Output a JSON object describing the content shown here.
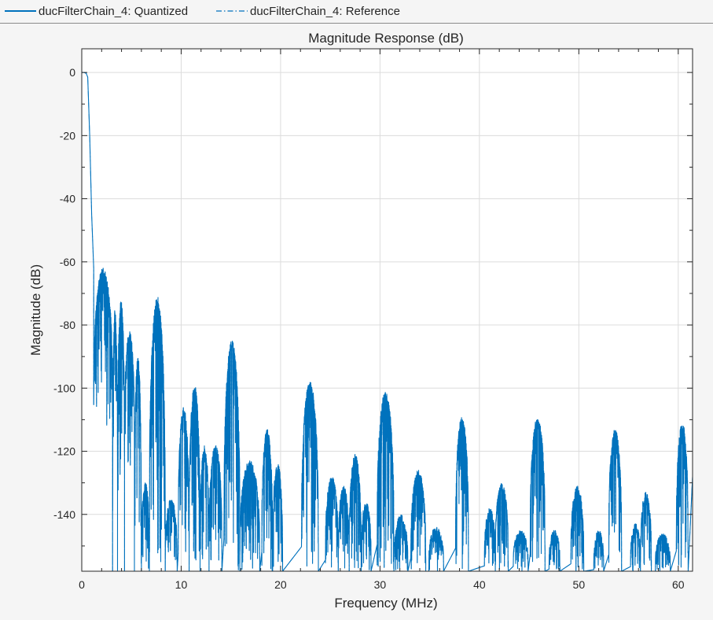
{
  "legend": {
    "items": [
      {
        "label": "ducFilterChain_4: Quantized",
        "style": "solid"
      },
      {
        "label": "ducFilterChain_4: Reference",
        "style": "dashdot"
      }
    ]
  },
  "colors": {
    "series": "#0072bd",
    "grid": "#dcdcdc",
    "axis": "#262626",
    "background": "#ffffff",
    "panel": "#f5f5f5"
  },
  "chart_data": {
    "type": "line",
    "title": "Magnitude Response (dB)",
    "xlabel": "Frequency (MHz)",
    "ylabel": "Magnitude (dB)",
    "xlim": [
      0,
      61.44
    ],
    "ylim": [
      -158,
      7.5
    ],
    "xticks": [
      0,
      10,
      20,
      30,
      40,
      50,
      60
    ],
    "xtick_labels": [
      "0",
      "10",
      "20",
      "30",
      "40",
      "50",
      "60"
    ],
    "yticks": [
      0,
      -20,
      -40,
      -60,
      -80,
      -100,
      -120,
      -140
    ],
    "ytick_labels": [
      "0",
      "-20",
      "-40",
      "-60",
      "-80",
      "-100",
      "-120",
      "-140"
    ],
    "grid": true,
    "legend_position": "top",
    "passband": {
      "x": [
        0,
        0.25,
        0.45,
        0.6
      ],
      "y": [
        0,
        0,
        -0.3,
        -1.5
      ]
    },
    "transition": {
      "x": [
        0.6,
        0.8,
        1.0,
        1.2
      ],
      "y": [
        -1.5,
        -20,
        -45,
        -62
      ]
    },
    "lobes": [
      {
        "start": 1.2,
        "end": 3.1,
        "peak": -62,
        "floor": -112
      },
      {
        "start": 2.2,
        "end": 3.6,
        "peak": -75,
        "floor": -140
      },
      {
        "start": 3.2,
        "end": 4.3,
        "peak": -72,
        "floor": -133
      },
      {
        "start": 4.3,
        "end": 5.3,
        "peak": -82,
        "floor": -125
      },
      {
        "start": 5.3,
        "end": 6.0,
        "peak": -90,
        "floor": -158
      },
      {
        "start": 5.9,
        "end": 6.8,
        "peak": -130,
        "floor": -158
      },
      {
        "start": 6.8,
        "end": 8.4,
        "peak": -71,
        "floor": -158
      },
      {
        "start": 8.4,
        "end": 9.6,
        "peak": -135,
        "floor": -158
      },
      {
        "start": 9.7,
        "end": 10.8,
        "peak": -106,
        "floor": -158
      },
      {
        "start": 10.8,
        "end": 11.9,
        "peak": -99,
        "floor": -158
      },
      {
        "start": 11.9,
        "end": 12.8,
        "peak": -118,
        "floor": -158
      },
      {
        "start": 12.8,
        "end": 14.1,
        "peak": -118,
        "floor": -158
      },
      {
        "start": 14.3,
        "end": 15.9,
        "peak": -85,
        "floor": -158
      },
      {
        "start": 15.9,
        "end": 17.9,
        "peak": -123,
        "floor": -158
      },
      {
        "start": 18.1,
        "end": 19.2,
        "peak": -113,
        "floor": -158
      },
      {
        "start": 19.2,
        "end": 20.2,
        "peak": -124,
        "floor": -158
      },
      {
        "start": 22.1,
        "end": 23.8,
        "peak": -98,
        "floor": -158
      },
      {
        "start": 24.5,
        "end": 25.8,
        "peak": -128,
        "floor": -158
      },
      {
        "start": 25.8,
        "end": 26.9,
        "peak": -131,
        "floor": -158
      },
      {
        "start": 26.9,
        "end": 28.1,
        "peak": -121,
        "floor": -158
      },
      {
        "start": 28.1,
        "end": 29.1,
        "peak": -136,
        "floor": -158
      },
      {
        "start": 29.7,
        "end": 31.4,
        "peak": -101,
        "floor": -158
      },
      {
        "start": 31.4,
        "end": 32.8,
        "peak": -140,
        "floor": -158
      },
      {
        "start": 33.1,
        "end": 34.6,
        "peak": -126,
        "floor": -158
      },
      {
        "start": 34.9,
        "end": 36.4,
        "peak": -144,
        "floor": -158
      },
      {
        "start": 37.6,
        "end": 38.9,
        "peak": -109,
        "floor": -158
      },
      {
        "start": 40.5,
        "end": 41.6,
        "peak": -138,
        "floor": -158
      },
      {
        "start": 41.6,
        "end": 42.9,
        "peak": -130,
        "floor": -158
      },
      {
        "start": 43.4,
        "end": 44.9,
        "peak": -145,
        "floor": -158
      },
      {
        "start": 45.1,
        "end": 46.6,
        "peak": -109,
        "floor": -158
      },
      {
        "start": 47.0,
        "end": 48.1,
        "peak": -145,
        "floor": -158
      },
      {
        "start": 49.2,
        "end": 50.5,
        "peak": -131,
        "floor": -158
      },
      {
        "start": 51.5,
        "end": 52.5,
        "peak": -145,
        "floor": -158
      },
      {
        "start": 53.0,
        "end": 54.3,
        "peak": -113,
        "floor": -158
      },
      {
        "start": 55.2,
        "end": 56.2,
        "peak": -143,
        "floor": -158
      },
      {
        "start": 56.2,
        "end": 57.3,
        "peak": -133,
        "floor": -158
      },
      {
        "start": 57.7,
        "end": 59.2,
        "peak": -146,
        "floor": -158
      },
      {
        "start": 59.8,
        "end": 61.0,
        "peak": -111,
        "floor": -158
      }
    ]
  }
}
